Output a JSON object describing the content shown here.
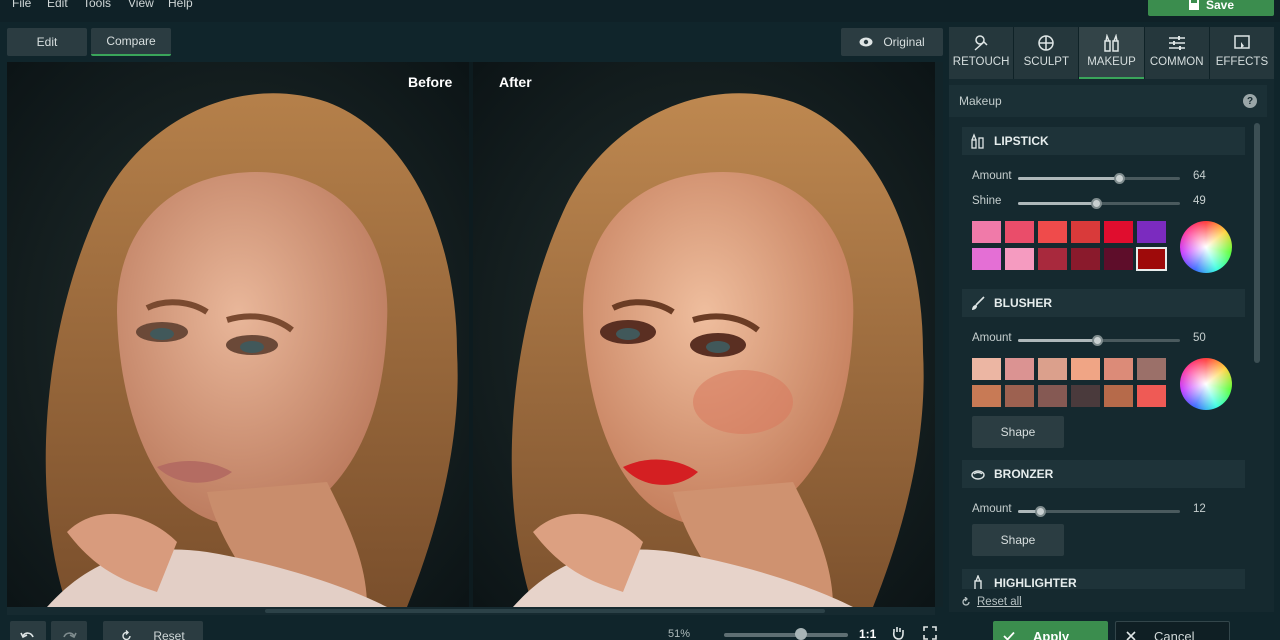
{
  "menu": [
    "File",
    "Edit",
    "Tools",
    "View",
    "Help"
  ],
  "save_label": "Save",
  "view_tabs": {
    "edit": "Edit",
    "compare": "Compare",
    "original": "Original"
  },
  "canvas": {
    "before_label": "Before",
    "after_label": "After"
  },
  "tool_tabs": [
    {
      "label": "RETOUCH",
      "icon": "retouch-icon"
    },
    {
      "label": "SCULPT",
      "icon": "sculpt-icon"
    },
    {
      "label": "MAKEUP",
      "icon": "makeup-icon",
      "active": true
    },
    {
      "label": "COMMON",
      "icon": "sliders-icon"
    },
    {
      "label": "EFFECTS",
      "icon": "effects-icon"
    }
  ],
  "panel_title": "Makeup",
  "help": "?",
  "lipstick": {
    "title": "LIPSTICK",
    "amount": {
      "label": "Amount",
      "value": "64"
    },
    "shine": {
      "label": "Shine",
      "value": "49"
    },
    "swatches": [
      "#f07aa9",
      "#ea4d6a",
      "#ef4b4b",
      "#d93a3a",
      "#e00d2e",
      "#7b2bbf",
      "#e46fd5",
      "#f59bc0",
      "#a8293d",
      "#8a1a2c",
      "#5e0d2a",
      "#9e0a0a"
    ]
  },
  "blusher": {
    "title": "BLUSHER",
    "amount": {
      "label": "Amount",
      "value": "50"
    },
    "swatches": [
      "#ecb6a3",
      "#db9392",
      "#dba08c",
      "#f0a585",
      "#dc8b78",
      "#9b7069",
      "#c87a55",
      "#9d6150",
      "#855953",
      "#4a3a3c",
      "#b66a4a",
      "#ef5a55"
    ],
    "shape": "Shape"
  },
  "bronzer": {
    "title": "BRONZER",
    "amount": {
      "label": "Amount",
      "value": "12"
    },
    "shape": "Shape"
  },
  "highlighter": {
    "title": "HIGHLIGHTER"
  },
  "reset_all": "Reset all",
  "bottom": {
    "reset": "Reset",
    "zoom": "51%",
    "one_to_one": "1:1",
    "apply": "Apply",
    "cancel": "Cancel"
  }
}
